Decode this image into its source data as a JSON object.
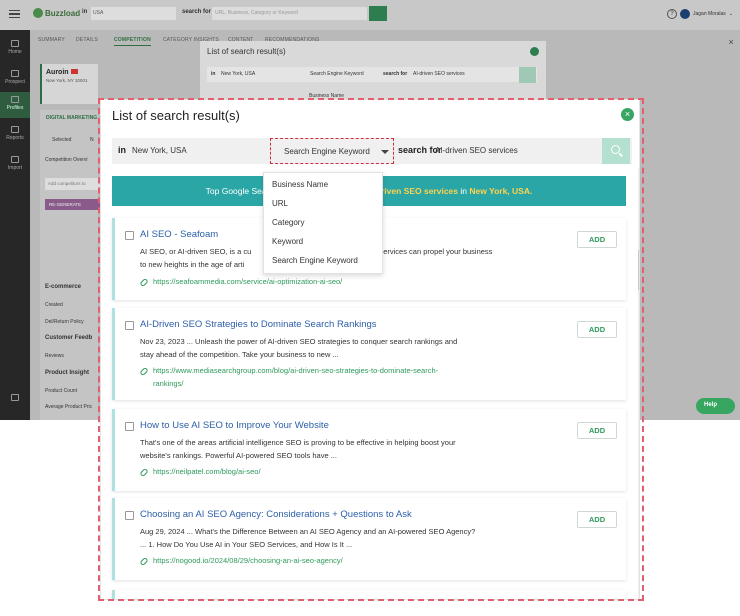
{
  "colors": {
    "accent_green": "#38a564",
    "banner_teal": "#2ba6a6",
    "highlight_yellow": "#ffd34d",
    "link_green": "#2e9a5c",
    "title_blue": "#2d5fa8",
    "dashed_red": "#d12d3b"
  },
  "background_app": {
    "logo": "Buzzload",
    "search": {
      "in_label": "in",
      "location": "USA",
      "search_for_label": "search for",
      "placeholder": "URL, Business, Category or Keyword"
    },
    "user_name": "Jagan Moralas",
    "nav": [
      "Home",
      "Prospect",
      "Profiles",
      "Reports",
      "Import"
    ],
    "tabs": [
      "SUMMARY",
      "DETAILS",
      "COMPETITION",
      "CATEGORY INSIGHTS",
      "CONTENT",
      "RECOMMENDATIONS"
    ],
    "profile_name": "Auroin",
    "profile_location": "New York, NY 10001",
    "section_label": "DIGITAL MARKETING",
    "status_selected": "Selected",
    "status_not": "N",
    "competition_label": "Competition Overvi",
    "add_competitor": "Add competitors to",
    "regenerate": "RE-GENERATE",
    "ecommerce": "E-commerce",
    "created": "Created",
    "del_return": "Del/Return Policy",
    "customer_feedback": "Customer Feedb",
    "reviews": "Reviews",
    "product_insight": "Product Insight",
    "product_count": "Product Count",
    "avg_product_price": "Average Product Pric",
    "help": "Help"
  },
  "small_dialog": {
    "title": "List of search result(s)",
    "in_label": "in",
    "location": "New York, USA",
    "select_value": "Search Engine Keyword",
    "search_for_label": "search for",
    "term": "AI-driven SEO services",
    "peek_option": "Business Name"
  },
  "dialog": {
    "title": "List of search result(s)",
    "in_label": "in",
    "location": "New York, USA",
    "select_value": "Search Engine Keyword",
    "search_for_label": "search for",
    "term": "AI-driven SEO services",
    "banner": {
      "prefix": "Top Google Search E",
      "term": "AI-driven SEO services",
      "mid": " in ",
      "location": "New York, USA."
    },
    "dropdown_options": [
      "Business Name",
      "URL",
      "Category",
      "Keyword",
      "Search Engine Keyword"
    ],
    "add_label": "ADD",
    "results": [
      {
        "title": "AI SEO - Seafoam",
        "snippet_lines": [
          "AI SEO, or AI-driven SEO, is a cu",
          ". services can propel your business",
          "to new heights in the age of arti"
        ],
        "url_lines": [
          "https://seafoammedia.com/service/ai-optimization-ai-seo/"
        ]
      },
      {
        "title": "AI-Driven SEO Strategies to Dominate Search Rankings",
        "snippet_lines": [
          "Nov 23, 2023 ... Unleash the power of AI-driven SEO strategies to conquer search rankings and",
          "stay ahead of the competition. Take your business to new ..."
        ],
        "url_lines": [
          "https://www.mediasearchgroup.com/blog/ai-driven-seo-strategies-to-dominate-search-",
          "rankings/"
        ]
      },
      {
        "title": "How to Use AI SEO to Improve Your Website",
        "snippet_lines": [
          "That's one of the areas artificial intelligence SEO is proving to be effective in helping boost your",
          "website's rankings. Powerful AI-powered SEO tools have ..."
        ],
        "url_lines": [
          "https://neilpatel.com/blog/ai-seo/"
        ]
      },
      {
        "title": "Choosing an AI SEO Agency: Considerations + Questions to Ask",
        "snippet_lines": [
          "Aug 29, 2024 ... What's the Difference Between an AI SEO Agency and an AI-powered SEO Agency?",
          "... 1. How Do You Use AI in Your SEO Services, and How Is It ..."
        ],
        "url_lines": [
          "https://nogood.io/2024/08/29/choosing-an-ai-seo-agency/"
        ]
      }
    ]
  }
}
